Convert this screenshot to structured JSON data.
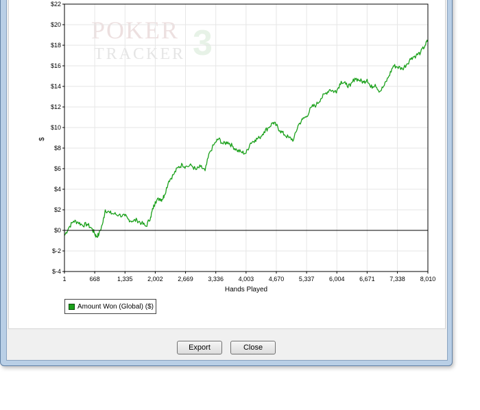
{
  "watermark": {
    "line1": "POKER",
    "line2": "TRACKER",
    "mark": "3"
  },
  "buttons": {
    "export": "Export",
    "close": "Close"
  },
  "chart_data": {
    "type": "line",
    "xlabel": "Hands Played",
    "ylabel": "$",
    "xlim": [
      1,
      8010
    ],
    "ylim": [
      -4,
      22
    ],
    "xticks": [
      1,
      668,
      1335,
      2002,
      2669,
      3336,
      4003,
      4670,
      5337,
      6004,
      6671,
      7338,
      8010
    ],
    "xtick_labels": [
      "1",
      "668",
      "1,335",
      "2,002",
      "2,669",
      "3,336",
      "4,003",
      "4,670",
      "5,337",
      "6,004",
      "6,671",
      "7,338",
      "8,010"
    ],
    "yticks": [
      -4,
      -2,
      0,
      2,
      4,
      6,
      8,
      10,
      12,
      14,
      16,
      18,
      20,
      22
    ],
    "ytick_labels": [
      "$-4",
      "$-2",
      "$0",
      "$2",
      "$4",
      "$6",
      "$8",
      "$10",
      "$12",
      "$14",
      "$16",
      "$18",
      "$20",
      "$22"
    ],
    "grid": true,
    "legend": "bottom-left",
    "series": [
      {
        "name": "Amount Won (Global) ($)",
        "color": "#1aa01a",
        "x": [
          1,
          100,
          200,
          300,
          400,
          500,
          600,
          668,
          700,
          760,
          850,
          900,
          1000,
          1100,
          1200,
          1335,
          1400,
          1500,
          1600,
          1700,
          1800,
          1900,
          1950,
          2002,
          2100,
          2150,
          2200,
          2300,
          2400,
          2500,
          2600,
          2669,
          2800,
          2900,
          3000,
          3100,
          3200,
          3336,
          3400,
          3500,
          3600,
          3700,
          3800,
          3900,
          4003,
          4100,
          4200,
          4300,
          4400,
          4500,
          4600,
          4670,
          4750,
          4850,
          4950,
          5050,
          5150,
          5250,
          5337,
          5450,
          5550,
          5650,
          5750,
          5850,
          5950,
          6004,
          6100,
          6200,
          6300,
          6400,
          6500,
          6600,
          6671,
          6750,
          6850,
          6950,
          7050,
          7150,
          7250,
          7338,
          7450,
          7550,
          7650,
          7750,
          7850,
          7950,
          8010
        ],
        "y": [
          -0.5,
          0.3,
          0.9,
          0.8,
          0.5,
          0.6,
          0.2,
          -0.3,
          -0.6,
          -0.4,
          0.8,
          2.0,
          1.7,
          1.6,
          1.5,
          1.4,
          1.1,
          0.9,
          1.0,
          0.7,
          0.4,
          1.3,
          2.1,
          2.8,
          3.1,
          3.0,
          3.4,
          4.8,
          5.4,
          6.1,
          6.4,
          6.2,
          6.3,
          5.9,
          6.2,
          5.8,
          7.6,
          8.6,
          8.9,
          8.4,
          8.6,
          8.2,
          7.8,
          7.6,
          7.5,
          8.5,
          8.8,
          9.0,
          9.6,
          10.0,
          10.5,
          10.2,
          9.7,
          9.3,
          9.0,
          8.8,
          10.2,
          10.8,
          11.1,
          12.0,
          12.2,
          12.8,
          13.3,
          13.7,
          13.5,
          13.6,
          14.5,
          14.2,
          14.0,
          14.8,
          14.6,
          14.4,
          14.7,
          13.9,
          14.2,
          13.5,
          14.1,
          15.0,
          16.0,
          15.9,
          15.7,
          16.2,
          16.8,
          17.0,
          17.3,
          18.0,
          18.5
        ]
      }
    ]
  }
}
